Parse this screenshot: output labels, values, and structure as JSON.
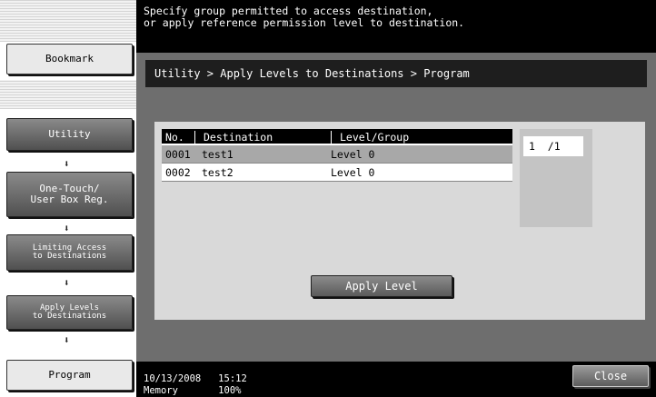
{
  "message": {
    "line1": "Specify group permitted to access destination,",
    "line2": "or apply reference permission level to destination."
  },
  "breadcrumb": "Utility > Apply Levels to Destinations > Program",
  "sidebar": {
    "bookmark": "Bookmark",
    "steps": [
      {
        "line1": "Utility",
        "line2": ""
      },
      {
        "line1": "One-Touch/",
        "line2": "User Box Reg."
      },
      {
        "line1": "Limiting Access",
        "line2": "to Destinations"
      },
      {
        "line1": "Apply Levels",
        "line2": "to Destinations"
      },
      {
        "line1": "Program",
        "line2": ""
      }
    ],
    "arrow": "⬇"
  },
  "table": {
    "headers": {
      "no": "No.",
      "destination": "Destination",
      "level": "Level/Group"
    },
    "rows": [
      {
        "no": "0001",
        "destination": "test1",
        "level": "Level 0"
      },
      {
        "no": "0002",
        "destination": "test2",
        "level": "Level 0"
      }
    ]
  },
  "page_indicator": "1  /1",
  "apply_button": "Apply Level",
  "status": {
    "date": "10/13/2008   15:12",
    "memory": "Memory       100%"
  },
  "close_button": "Close"
}
